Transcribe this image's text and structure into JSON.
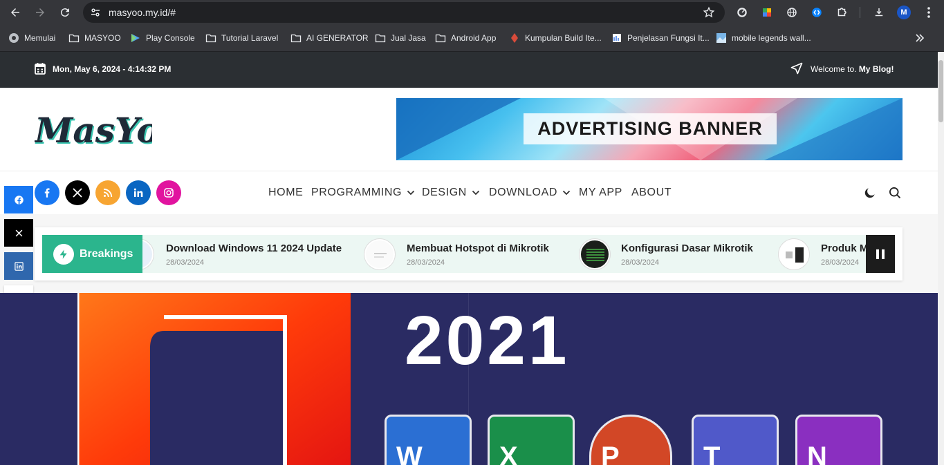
{
  "browser": {
    "url": "masyoo.my.id/#",
    "profile_initial": "M",
    "bookmarks": [
      "Memulai",
      "MASYOO",
      "Play Console",
      "Tutorial Laravel",
      "AI GENERATOR",
      "Jual Jasa",
      "Android App",
      "Kumpulan Build Ite...",
      "Penjelasan Fungsi It...",
      "mobile legends wall..."
    ]
  },
  "topbar": {
    "datetime": "Mon, May 6, 2024 - 4:14:32 PM",
    "welcome_prefix": "Welcome to.",
    "welcome_bold": "My Blog!"
  },
  "header": {
    "logo_text": "MasYoO",
    "ad_banner": "ADVERTISING BANNER"
  },
  "nav": {
    "items": [
      "HOME",
      "PROGRAMMING",
      "DESIGN",
      "DOWNLOAD",
      "MY APP",
      "ABOUT"
    ]
  },
  "breaking": {
    "label": "Breakings",
    "items": [
      {
        "title": "Download Windows 11 2024 Update",
        "date": "28/03/2024"
      },
      {
        "title": "Membuat Hotspot di Mikrotik",
        "date": "28/03/2024"
      },
      {
        "title": "Konfigurasi Dasar Mikrotik",
        "date": "28/03/2024"
      },
      {
        "title": "Produk M",
        "date": "28/03/2024"
      }
    ]
  },
  "hero": {
    "year": "2021",
    "apps": [
      "W",
      "X",
      "P",
      "T",
      "N"
    ]
  },
  "colors": {
    "accent": "#2bb58d",
    "topbar": "#2b2f33",
    "hero_bg": "#2a2b63"
  }
}
